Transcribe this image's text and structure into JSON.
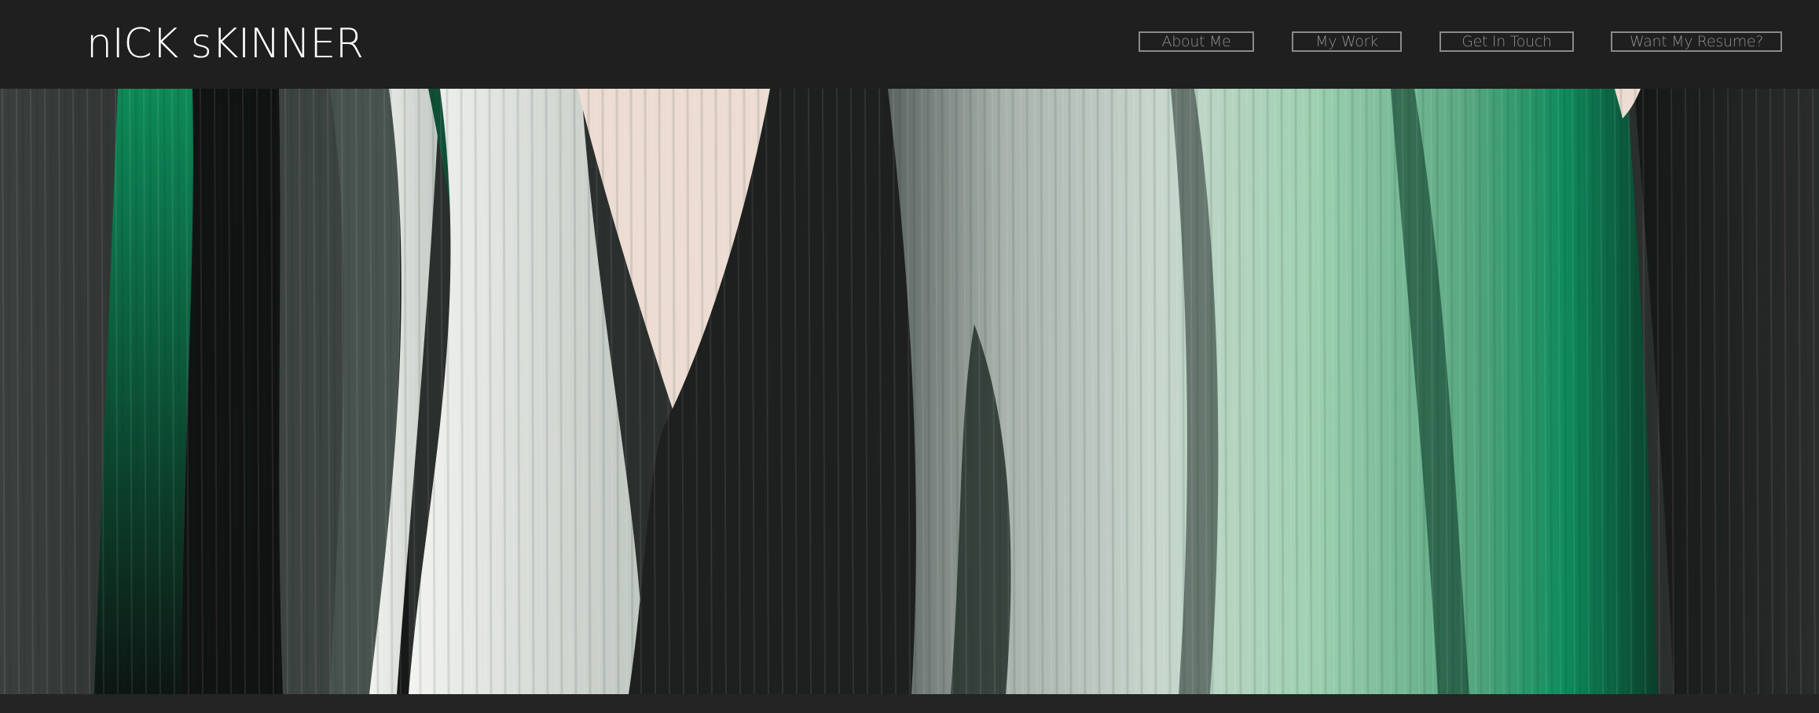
{
  "site": {
    "brand": "nICK sKINNER"
  },
  "nav": {
    "items": [
      {
        "label": "About Me"
      },
      {
        "label": "My Work"
      },
      {
        "label": "Get In Touch"
      },
      {
        "label": "Want My Resume?"
      }
    ]
  },
  "hero": {
    "image_description_icon": "abstract-painting",
    "palette": {
      "dark": "#1c1f1e",
      "green": "#0e7a52",
      "mint": "#9fd7b4",
      "white": "#e9ece8",
      "peach": "#ecdcd2"
    }
  }
}
